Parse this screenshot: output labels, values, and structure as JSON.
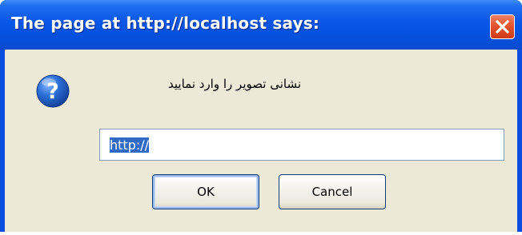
{
  "dialog": {
    "title": "The page at http://localhost says:",
    "message": "نشانی تصویر را وارد نمایید",
    "input_value": "http://",
    "ok_label": "OK",
    "cancel_label": "Cancel",
    "icon": "question-icon",
    "close_icon": "close-icon"
  },
  "colors": {
    "titlebar": "#0a56e6",
    "client": "#ece9d8",
    "close_button": "#e4502c",
    "question_icon": "#2b6fd6"
  }
}
